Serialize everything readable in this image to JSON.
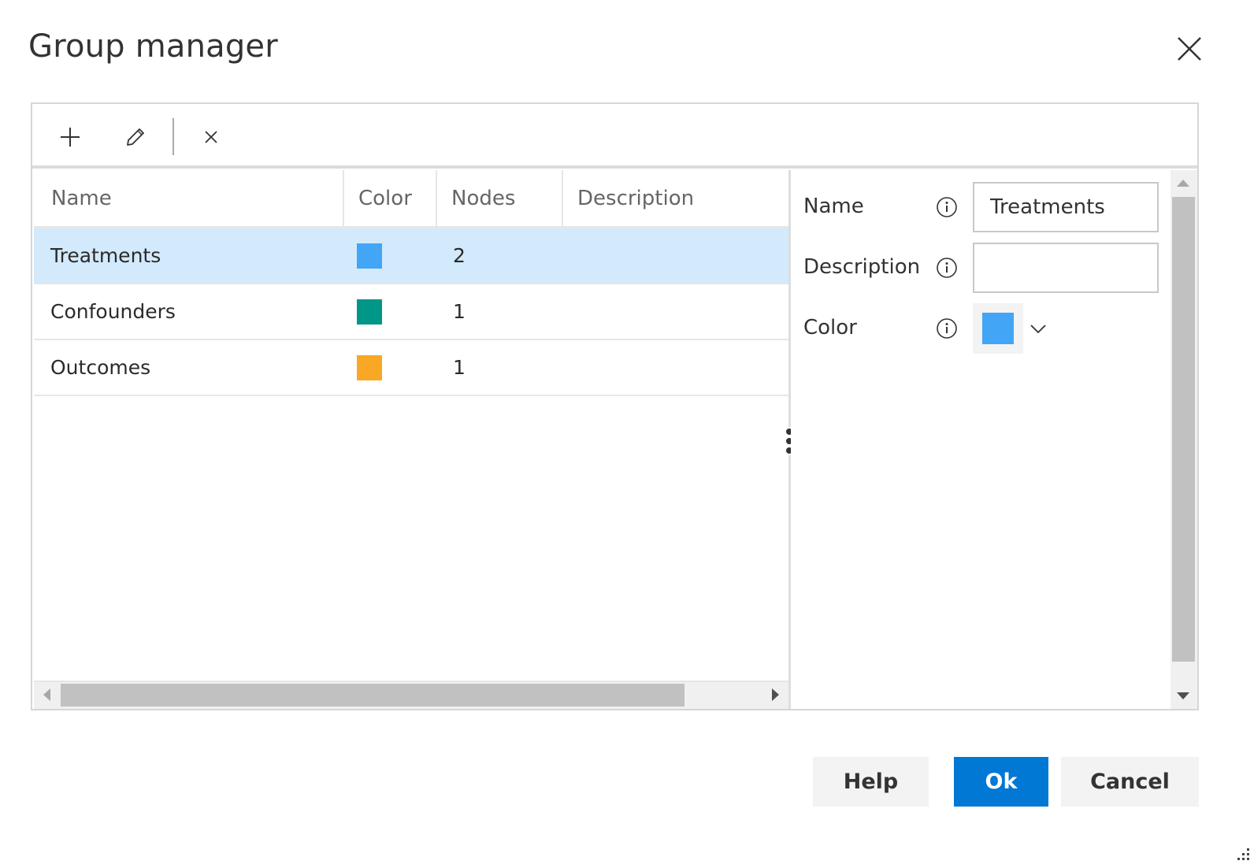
{
  "dialog": {
    "title": "Group manager",
    "close_icon": "close-icon"
  },
  "toolbar": {
    "add_icon": "plus-icon",
    "edit_icon": "pencil-icon",
    "delete_icon": "x-icon"
  },
  "grid": {
    "columns": [
      "Name",
      "Color",
      "Nodes",
      "Description"
    ],
    "rows": [
      {
        "name": "Treatments",
        "color": "#42a5f5",
        "nodes": "2",
        "description": "",
        "selected": true
      },
      {
        "name": "Confounders",
        "color": "#009688",
        "nodes": "1",
        "description": "",
        "selected": false
      },
      {
        "name": "Outcomes",
        "color": "#f9a825",
        "nodes": "1",
        "description": "",
        "selected": false
      }
    ]
  },
  "properties": {
    "name_label": "Name",
    "name_value": "Treatments",
    "description_label": "Description",
    "description_value": "",
    "color_label": "Color",
    "color_value": "#42a5f5"
  },
  "buttons": {
    "help": "Help",
    "ok": "Ok",
    "cancel": "Cancel"
  },
  "colors": {
    "accent": "#0078d4",
    "selection": "#d2eafb"
  }
}
